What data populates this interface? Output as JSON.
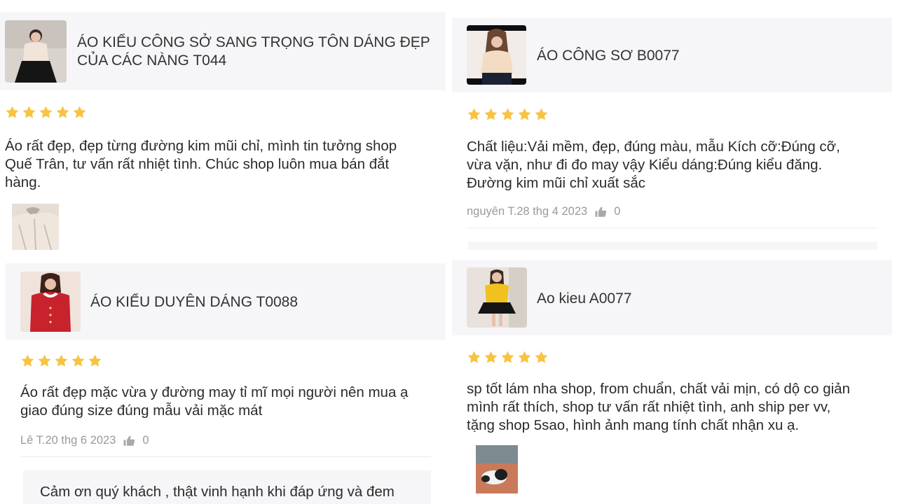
{
  "colors": {
    "star": "#f7c341",
    "card_bg": "#f6f6f8",
    "meta": "#9a9a9a"
  },
  "reviews": [
    {
      "product": {
        "name_line1": "ÁO KIỂU CÔNG SỞ SANG TRỌNG TÔN DÁNG ĐẸP",
        "name_line2": "CỦA CÁC NÀNG  T044"
      },
      "rating": 5,
      "text_lines": [
        "Áo rất đẹp, đẹp từng đường kim mũi chỉ, mình tin tưởng shop",
        "Quế Trân, tư vấn rất nhiệt tình. Chúc shop luôn mua bán đắt",
        "hàng."
      ],
      "photo_icon": "blouse-photo"
    },
    {
      "product": {
        "name_line1": "ÁO CÔNG SƠ B0077"
      },
      "rating": 5,
      "text_lines": [
        "Chất liệu:Vải mềm, đẹp, đúng màu, mẫu Kích cỡ:Đúng cỡ,",
        "vừa vặn, như đi đo may vậy Kiểu dáng:Đúng kiểu đăng.",
        "Đường kim mũi chỉ xuất sắc"
      ],
      "meta": {
        "author_date": "nguyên T.28 thg 4 2023",
        "likes": "0"
      }
    },
    {
      "product": {
        "name_line1": "ÁO KIỂU DUYÊN DÁNG T0088"
      },
      "rating": 5,
      "text_lines": [
        "Áo rất đẹp mặc vừa y đường may tỉ mĩ mọi người nên mua ạ",
        "giao đúng size đúng mẫu vải mặc mát"
      ],
      "meta": {
        "author_date": "Lê T.20 thg 6 2023",
        "likes": "0"
      },
      "reply": "Cảm ơn quý khách , thật vinh hạnh khi đáp ứng và đem"
    },
    {
      "product": {
        "name_line1": "Ao kieu  A0077"
      },
      "rating": 5,
      "text_lines": [
        "sp tốt lám nha shop, from chuẩn, chất vải mịn, có dộ co giản",
        "mình rất thích, shop tư vấn rất nhiệt tình, anh ship per vv,",
        "tặng shop 5sao, hình ảnh mang tính chất nhận xu ạ."
      ],
      "photo_icon": "dog-photo"
    }
  ]
}
